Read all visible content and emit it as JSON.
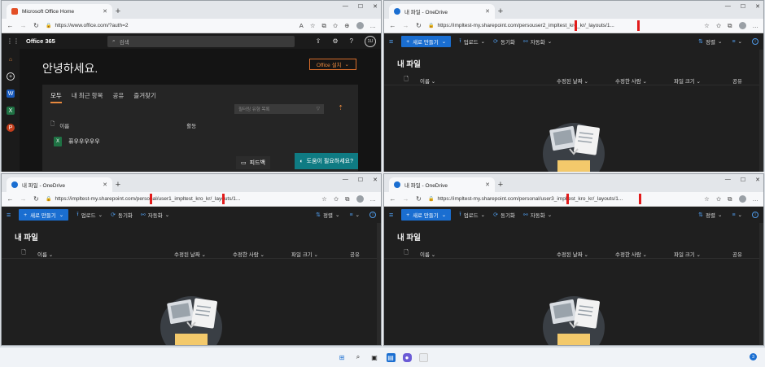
{
  "office_window": {
    "tab_title": "Microsoft Office Home",
    "url": "https://www.office.com/?auth=2",
    "app_title": "Office 365",
    "search_placeholder": "검색",
    "avatar_initials": "1U",
    "greeting": "안녕하세요.",
    "install_label": "Office 설치",
    "filter_tabs": [
      "모두",
      "내 최근 항목",
      "공유",
      "즐겨찾기"
    ],
    "filter_placeholder": "필터링 유형 목록",
    "col_name": "이름",
    "col_activity": "활동",
    "file_name": "퓨우우우우우",
    "feedback_label": "피드백",
    "help_label": "도움이 필요하세요?"
  },
  "onedrive_windows": [
    {
      "id": "tr",
      "tab_title": "내 파일 - OneDrive",
      "url_prefix": "https://impltest-my.sharepoint.com/perso",
      "url_highlight": "user2_impltest_kro_kr/",
      "url_suffix": "_layouts/1..."
    },
    {
      "id": "bl",
      "tab_title": "내 파일 - OneDrive",
      "url_prefix": "https://impltest-my.sharepoint.com/perso",
      "url_highlight": "nal/user1_impltest_kro_kr/",
      "url_suffix": "_layouts/1..."
    },
    {
      "id": "br",
      "tab_title": "내 파일 - OneDrive",
      "url_prefix": "https://impltest-my.sharepoint.com/perso",
      "url_highlight": "nal/user3_impltest_kro_kr/",
      "url_suffix": "_layouts/1..."
    }
  ],
  "onedrive": {
    "new_label": "새로 만들기",
    "upload_label": "업로드",
    "sync_label": "동기화",
    "automate_label": "자동화",
    "sort_label": "정렬",
    "page_title": "내 파일",
    "col_name": "이름",
    "col_modified": "수정된 날짜",
    "col_modified_by": "수정한 사람",
    "col_size": "파일 크기",
    "col_sharing": "공유"
  },
  "colors": {
    "highlight_box": "#e21b1b",
    "onedrive_blue": "#1a6ed1",
    "office_orange": "#e8893e",
    "help_teal": "#0f7b83"
  }
}
